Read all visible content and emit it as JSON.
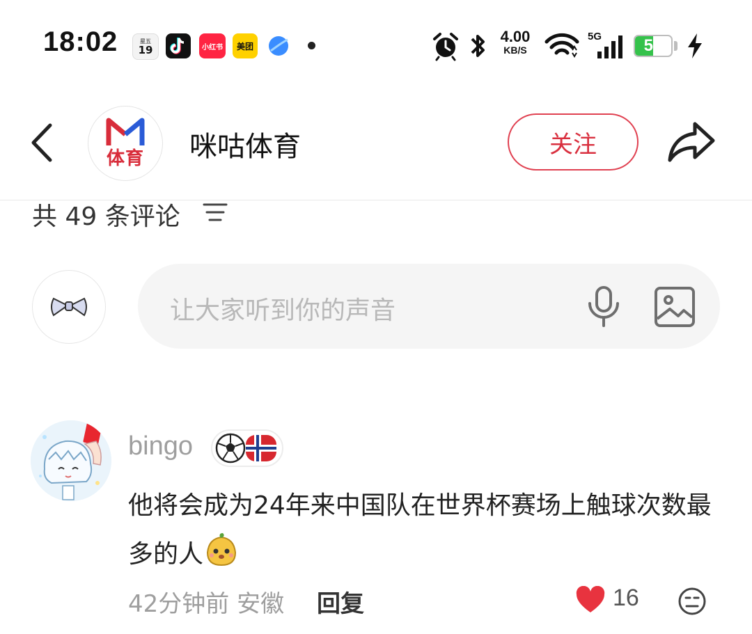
{
  "status_bar": {
    "time": "18:02",
    "calendar": {
      "weekday": "星五",
      "day": "19"
    },
    "notification_apps": [
      "tiktok-icon",
      "xiaohongshu-icon",
      "meituan-icon",
      "browser-icon"
    ],
    "xiaohongshu_label": "小红书",
    "meituan_label": "美团",
    "net_speed_value": "4.00",
    "net_speed_unit": "KB/S",
    "network_type": "5G",
    "battery_level": 50,
    "battery_text": "50",
    "colors": {
      "battery": "#35c24b"
    }
  },
  "header": {
    "channel_name": "咪咕体育",
    "channel_logo_text": "体育",
    "follow_label": "关注",
    "colors": {
      "accent": "#e04050"
    }
  },
  "comments_header": {
    "count_text": "共 49 条评论"
  },
  "input": {
    "placeholder": "让大家听到你的声音"
  },
  "comments": [
    {
      "user_name": "bingo",
      "badge": "football-norway-badge",
      "text": "他将会成为24年来中国队在世界杯赛场上触球次数最多的人",
      "meta": "42分钟前 安徽",
      "reply_label": "回复",
      "like_count": "16",
      "liked": true
    }
  ]
}
